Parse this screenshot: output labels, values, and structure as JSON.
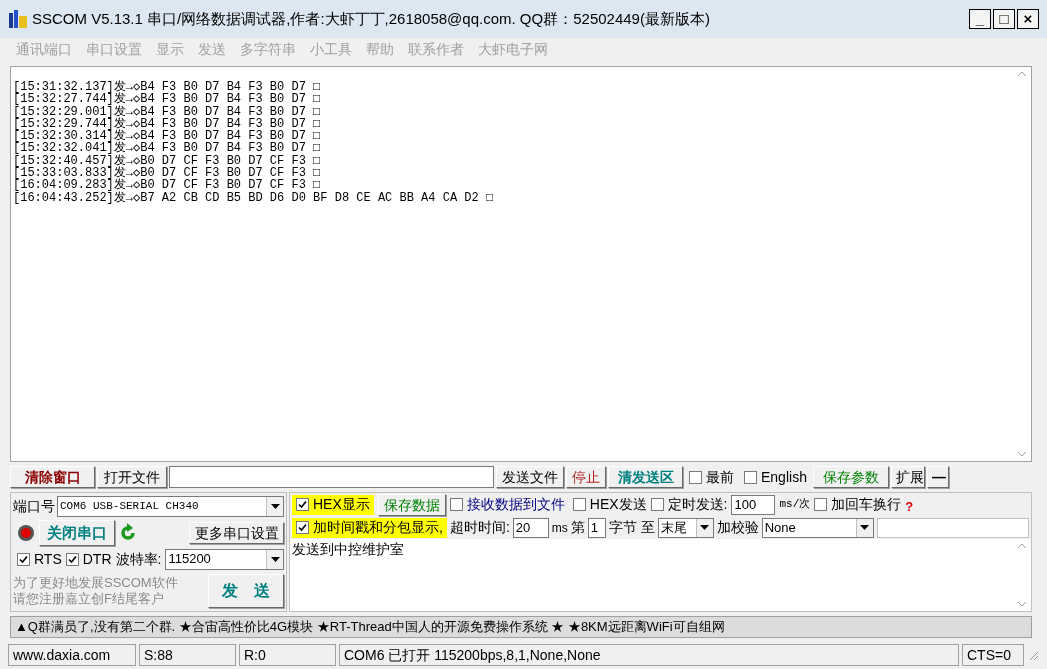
{
  "window": {
    "title": "SSCOM V5.13.1 串口/网络数据调试器,作者:大虾丁丁,2618058@qq.com. QQ群：52502449(最新版本)",
    "controls": [
      "_",
      "□",
      "×"
    ]
  },
  "menu": [
    "通讯端口",
    "串口设置",
    "显示",
    "发送",
    "多字符串",
    "小工具",
    "帮助",
    "联系作者",
    "大虾电子网"
  ],
  "log": [
    "[15:31:32.137]发→◇B4 F3 B0 D7 B4 F3 B0 D7 □",
    "[15:32:27.744]发→◇B4 F3 B0 D7 B4 F3 B0 D7 □",
    "[15:32:29.001]发→◇B4 F3 B0 D7 B4 F3 B0 D7 □",
    "[15:32:29.744]发→◇B4 F3 B0 D7 B4 F3 B0 D7 □",
    "[15:32:30.314]发→◇B4 F3 B0 D7 B4 F3 B0 D7 □",
    "[15:32:32.041]发→◇B4 F3 B0 D7 B4 F3 B0 D7 □",
    "[15:32:40.457]发→◇B0 D7 CF F3 B0 D7 CF F3 □",
    "[15:33:03.833]发→◇B0 D7 CF F3 B0 D7 CF F3 □",
    "[16:04:09.283]发→◇B0 D7 CF F3 B0 D7 CF F3 □",
    "[16:04:43.252]发→◇B7 A2 CB CD B5 BD D6 D0 BF D8 CE AC BB A4 CA D2 □"
  ],
  "toolbar": {
    "clear": "清除窗口",
    "open_file": "打开文件",
    "send_file": "发送文件",
    "stop": "停止",
    "clear_send": "清发送区",
    "topmost": {
      "label": "最前",
      "checked": false
    },
    "english": {
      "label": "English",
      "checked": false
    },
    "save_params": "保存参数",
    "extend": "扩展",
    "collapse": "—"
  },
  "port": {
    "label": "端口号",
    "value": "COM6 USB-SERIAL CH340",
    "open": true,
    "toggle": "关闭串口",
    "more": "更多串口设置",
    "rts": {
      "label": "RTS",
      "checked": true
    },
    "dtr": {
      "label": "DTR",
      "checked": true
    },
    "baud_label": "波特率:",
    "baud": "115200",
    "promo": [
      "为了更好地发展SSCOM软件",
      "请您注册嘉立创F结尾客户"
    ],
    "send": "发　送"
  },
  "options": {
    "hex_display": {
      "label": "HEX显示",
      "checked": true
    },
    "save_data": "保存数据",
    "recv_to_file": {
      "label": "接收数据到文件",
      "checked": false
    },
    "hex_send": {
      "label": "HEX发送",
      "checked": false
    },
    "timed_send": {
      "label": "定时发送:",
      "checked": false
    },
    "interval": "100",
    "interval_unit": "ms/次",
    "add_crlf": {
      "label": "加回车换行",
      "checked": false
    },
    "help": "?",
    "timestamp": {
      "label": "加时间戳和分包显示,",
      "checked": true
    },
    "timeout_label": "超时时间:",
    "timeout": "20",
    "timeout_unit": "ms",
    "from_label": "第",
    "from": "1",
    "bytes_label": "字节 至",
    "to": "末尾",
    "checksum_label": "加校验",
    "checksum": "None"
  },
  "send_text": "发送到中控维护室",
  "ticker": "▲Q群满员了,没有第二个群. ★合宙高性价比4G模块 ★RT-Thread中国人的开源免费操作系统 ★ ★8KM远距离WiFi可自组网",
  "status_bar": [
    "www.daxia.com",
    "S:88",
    "R:0",
    "COM6 已打开  115200bps,8,1,None,None",
    "CTS=0"
  ]
}
